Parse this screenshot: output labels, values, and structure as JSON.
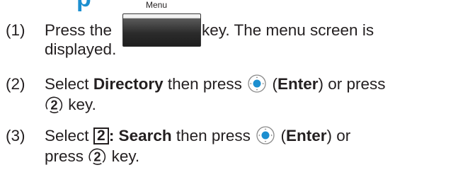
{
  "heading": "p",
  "menu_key_label": "Menu",
  "colors": {
    "heading": "#1c8fd0",
    "text": "#231f20"
  },
  "steps": [
    {
      "number": "(1)",
      "line1_a": "Press the",
      "line1_b": "key. The menu screen is",
      "line2": "displayed."
    },
    {
      "number": "(2)",
      "line1_a": "Select",
      "line1_bold": "Directory",
      "line1_b": "then press",
      "paren_open": "(",
      "enter_label": "Enter",
      "line1_c": ") or press",
      "digit": "2",
      "line2_b": "key."
    },
    {
      "number": "(3)",
      "line1_a": "Select",
      "box_digit": "2",
      "line1_bold": ": Search",
      "line1_b": "then press",
      "paren_open": "(",
      "enter_label": "Enter",
      "line1_c": ") or",
      "line2_a": "press",
      "digit": "2",
      "line2_b": "key."
    }
  ]
}
